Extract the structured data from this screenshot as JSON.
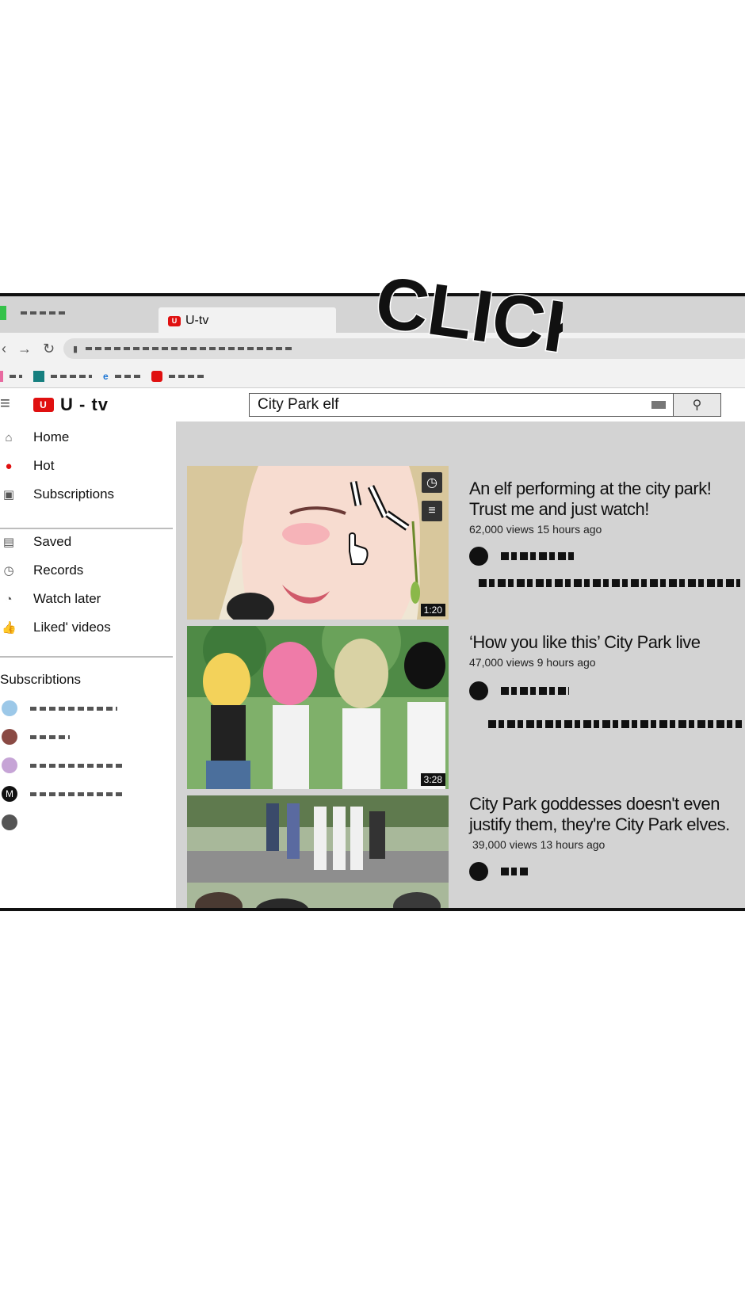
{
  "browser": {
    "active_tab_title": "U-tv",
    "tab_logo_letter": "U"
  },
  "app": {
    "logo_letter": "U",
    "name": "U - tv",
    "search_value": "City Park elf"
  },
  "sidebar": {
    "items": [
      {
        "label": "Home",
        "icon": "home-icon"
      },
      {
        "label": "Hot",
        "icon": "flame-icon"
      },
      {
        "label": "Subscriptions",
        "icon": "subscriptions-icon"
      },
      {
        "label": "Saved",
        "icon": "library-icon"
      },
      {
        "label": "Records",
        "icon": "history-icon"
      },
      {
        "label": "Watch later",
        "icon": "clock-icon"
      },
      {
        "label": "Liked' videos",
        "icon": "thumbs-up-icon"
      }
    ],
    "subscriptions_title": "Subscribtions"
  },
  "videos": [
    {
      "title_line1": "An elf performing at the city park!",
      "title_line2": "Trust me and just watch!",
      "meta": "62,000 views 15 hours ago",
      "duration": "1:20"
    },
    {
      "title_line1": "‘How you like this’ City Park live",
      "title_line2": "",
      "meta": "47,000 views 9 hours ago",
      "duration": "3:28"
    },
    {
      "title_line1": "City Park goddesses doesn't even",
      "title_line2": "justify them, they're City Park elves.",
      "meta": "39,000 views 13 hours ago",
      "duration": ""
    }
  ],
  "sfx": {
    "text": "CLICK"
  },
  "colors": {
    "brand_red": "#e01010",
    "content_bg": "#d3d3d3",
    "tabbar_bg": "#d4d4d4"
  }
}
